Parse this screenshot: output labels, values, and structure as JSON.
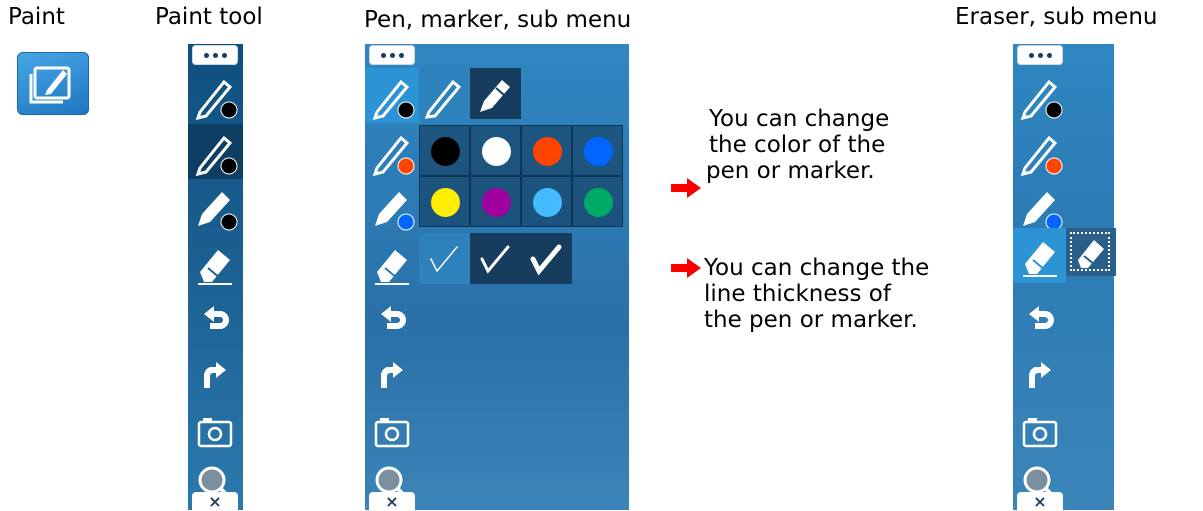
{
  "captions": {
    "paint": "Paint",
    "paint_tool": "Paint tool",
    "pen_submenu": "Pen, marker, sub menu",
    "eraser_submenu": "Eraser, sub menu"
  },
  "notes": {
    "color": [
      "You can change",
      "the color of the",
      "pen or marker."
    ],
    "thickness": [
      "You can change the",
      "line thickness of",
      "the pen or marker."
    ]
  },
  "toolbar": {
    "menu_icon": "ellipsis-icon",
    "close_label": "×",
    "tools": [
      "pen-black",
      "pen-black-2",
      "marker-black",
      "eraser",
      "undo",
      "redo",
      "camera",
      "zoom"
    ]
  },
  "submenu": {
    "pen_row": [
      "pen-black",
      "pen-thin",
      "marker"
    ],
    "colors": [
      "#000000",
      "#ffffff",
      "#ff4400",
      "#0066ff",
      "#ffee00",
      "#a000a0",
      "#44bbff",
      "#00aa66"
    ],
    "thickness": [
      "thin",
      "medium",
      "thick"
    ]
  },
  "colors": {
    "accent": "#2c93d4",
    "arrow": "#ff0000"
  }
}
